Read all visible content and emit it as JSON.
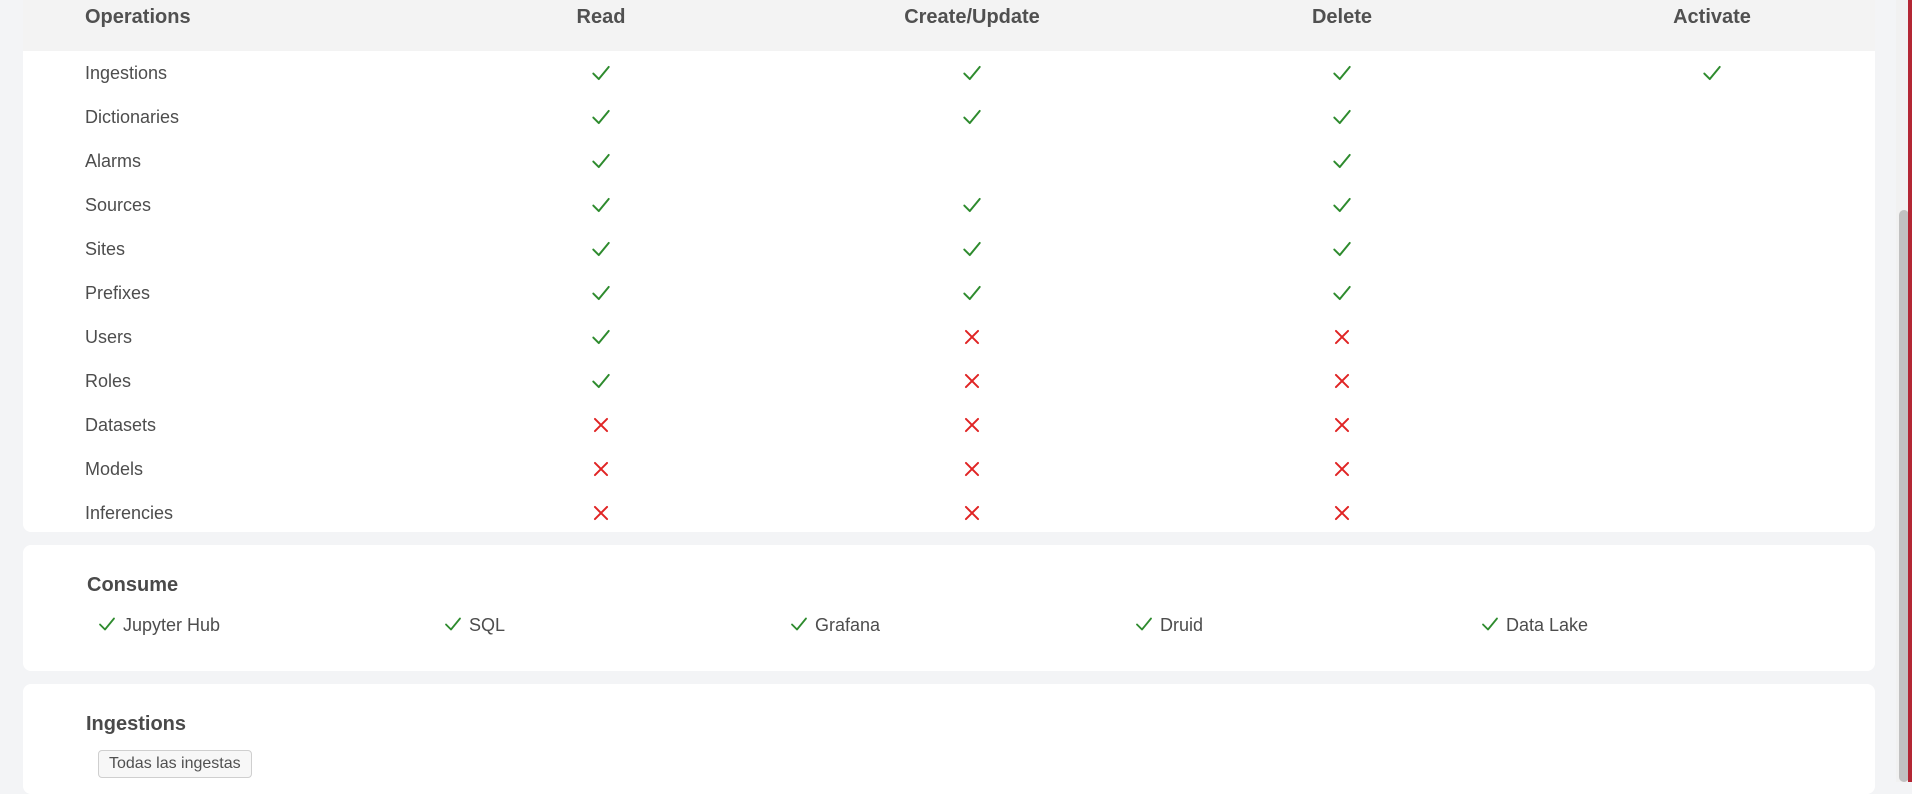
{
  "permissions": {
    "headers": [
      "Operations",
      "Read",
      "Create/Update",
      "Delete",
      "Activate"
    ],
    "rows": [
      {
        "label": "Ingestions",
        "values": [
          "yes",
          "yes",
          "yes",
          "yes"
        ]
      },
      {
        "label": "Dictionaries",
        "values": [
          "yes",
          "yes",
          "yes",
          ""
        ]
      },
      {
        "label": "Alarms",
        "values": [
          "yes",
          "",
          "yes",
          ""
        ]
      },
      {
        "label": "Sources",
        "values": [
          "yes",
          "yes",
          "yes",
          ""
        ]
      },
      {
        "label": "Sites",
        "values": [
          "yes",
          "yes",
          "yes",
          ""
        ]
      },
      {
        "label": "Prefixes",
        "values": [
          "yes",
          "yes",
          "yes",
          ""
        ]
      },
      {
        "label": "Users",
        "values": [
          "yes",
          "no",
          "no",
          ""
        ]
      },
      {
        "label": "Roles",
        "values": [
          "yes",
          "no",
          "no",
          ""
        ]
      },
      {
        "label": "Datasets",
        "values": [
          "no",
          "no",
          "no",
          ""
        ]
      },
      {
        "label": "Models",
        "values": [
          "no",
          "no",
          "no",
          ""
        ]
      },
      {
        "label": "Inferencies",
        "values": [
          "no",
          "no",
          "no",
          ""
        ]
      }
    ]
  },
  "consume": {
    "title": "Consume",
    "items": [
      "Jupyter Hub",
      "SQL",
      "Grafana",
      "Druid",
      "Data Lake"
    ]
  },
  "ingestions": {
    "title": "Ingestions",
    "tag": "Todas las ingestas"
  },
  "icons": {
    "yes": "check-icon",
    "no": "cross-icon"
  },
  "colors": {
    "check": "#2e8b2e",
    "cross": "#e02424",
    "accent": "#b32634"
  }
}
